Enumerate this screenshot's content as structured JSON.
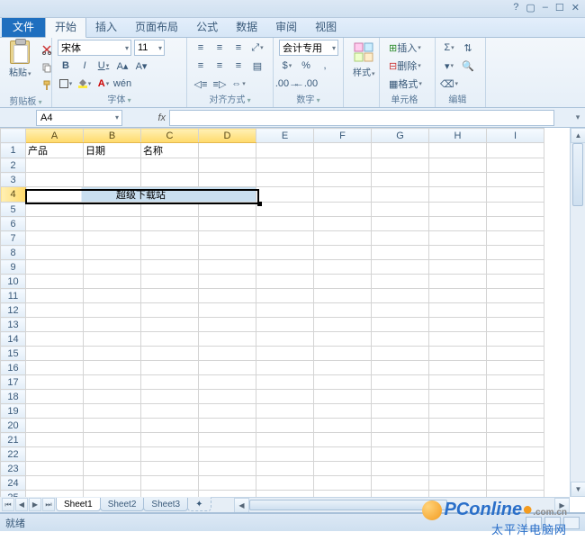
{
  "tabs": {
    "file": "文件",
    "items": [
      "开始",
      "插入",
      "页面布局",
      "公式",
      "数据",
      "审阅",
      "视图"
    ],
    "active_index": 0
  },
  "ribbon": {
    "clipboard": {
      "paste": "粘贴",
      "group_label": "剪贴板"
    },
    "font": {
      "name": "宋体",
      "size": "11",
      "bold": "B",
      "italic": "I",
      "underline": "U",
      "group_label": "字体"
    },
    "alignment": {
      "group_label": "对齐方式"
    },
    "number": {
      "format": "会计专用",
      "group_label": "数字"
    },
    "styles": {
      "label": "样式"
    },
    "cells": {
      "insert": "插入",
      "delete": "删除",
      "format": "格式",
      "group_label": "单元格"
    },
    "editing": {
      "group_label": "编辑"
    }
  },
  "formula_bar": {
    "name_box": "A4",
    "fx": "fx",
    "value": ""
  },
  "grid": {
    "columns": [
      "A",
      "B",
      "C",
      "D",
      "E",
      "F",
      "G",
      "H",
      "I"
    ],
    "row_count": 27,
    "headers_row1": {
      "A": "产品",
      "B": "日期",
      "C": "名称"
    },
    "merged_row4": "超级下载站",
    "selected_cols": [
      "A",
      "B",
      "C",
      "D"
    ],
    "selected_row": 4,
    "active_cell": "A4"
  },
  "sheet_tabs": {
    "items": [
      "Sheet1",
      "Sheet2",
      "Sheet3"
    ],
    "active_index": 0
  },
  "statusbar": {
    "mode": "就绪"
  },
  "watermark": {
    "brand": "PConline",
    "suffix": ".com.cn",
    "cn": "太平洋电脑网"
  }
}
